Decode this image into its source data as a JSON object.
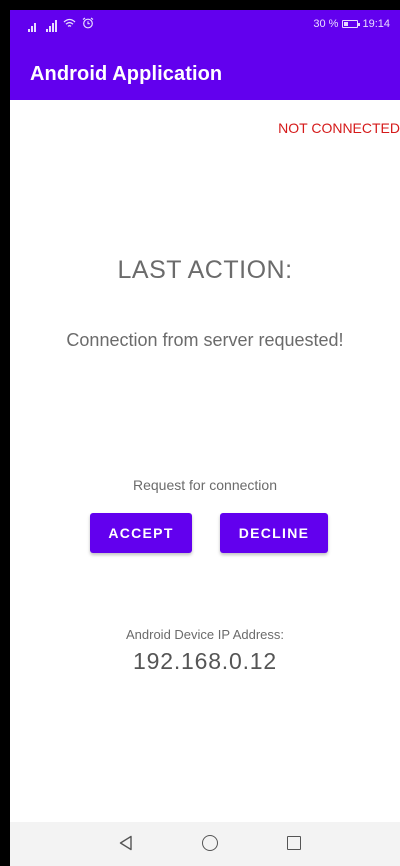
{
  "status_bar": {
    "battery": "30 %",
    "time": "19:14"
  },
  "app_bar": {
    "title": "Android Application"
  },
  "connection_status": {
    "text": "NOT CONNECTED",
    "color": "#d51a1a"
  },
  "last_action": {
    "heading": "LAST ACTION:",
    "value": "Connection from server requested!"
  },
  "request": {
    "label": "Request for connection",
    "accept_label": "ACCEPT",
    "decline_label": "DECLINE"
  },
  "device": {
    "ip_label": "Android Device IP Address:",
    "ip_value": "192.168.0.12"
  },
  "nav_bar": {
    "back_icon": "triangle-back-icon",
    "home_icon": "circle-home-icon",
    "recent_icon": "square-recents-icon"
  },
  "colors": {
    "primary": "#6200ee",
    "text_secondary": "#6b6b6b"
  }
}
